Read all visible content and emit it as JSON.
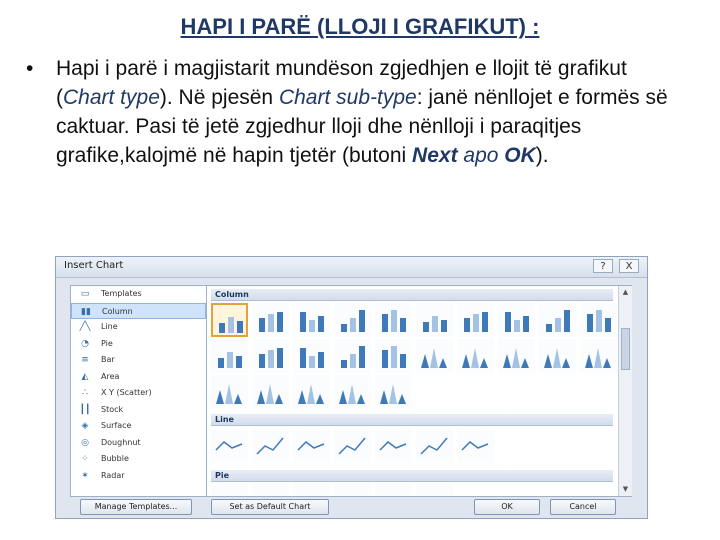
{
  "slide": {
    "title": "HAPI I PARË (LLOJI I GRAFIKUT) :",
    "bullet": {
      "part1": "Hapi i parë i magjistarit mundëson zgjedhjen e llojit të grafikut (",
      "chart_type": "Chart type",
      "part2": "). Në pjesën ",
      "chart_subtype": "Chart sub-type",
      "part3": ": janë  nënllojet e formës së caktuar. Pasi të jetë zgjedhur lloji dhe nënlloji i paraqitjes grafike,kalojmë në hapin tjetër (butoni ",
      "next": "Next",
      "apo": " apo ",
      "ok": "OK",
      "part4": ")."
    }
  },
  "dialog": {
    "title": "Insert Chart",
    "help_glyph": "?",
    "close_glyph": "X",
    "chart_types": [
      {
        "label": "Templates",
        "icon": "folder-icon",
        "glyph": "▭"
      },
      {
        "label": "Column",
        "icon": "column-chart-icon",
        "glyph": "▮▮",
        "selected": true
      },
      {
        "label": "Line",
        "icon": "line-chart-icon",
        "glyph": "╱╲"
      },
      {
        "label": "Pie",
        "icon": "pie-chart-icon",
        "glyph": "◔"
      },
      {
        "label": "Bar",
        "icon": "bar-chart-icon",
        "glyph": "≡"
      },
      {
        "label": "Area",
        "icon": "area-chart-icon",
        "glyph": "◭"
      },
      {
        "label": "X Y (Scatter)",
        "icon": "scatter-chart-icon",
        "glyph": "∴"
      },
      {
        "label": "Stock",
        "icon": "stock-chart-icon",
        "glyph": "┃┃"
      },
      {
        "label": "Surface",
        "icon": "surface-chart-icon",
        "glyph": "◈"
      },
      {
        "label": "Doughnut",
        "icon": "doughnut-chart-icon",
        "glyph": "◎"
      },
      {
        "label": "Bubble",
        "icon": "bubble-chart-icon",
        "glyph": "⁘"
      },
      {
        "label": "Radar",
        "icon": "radar-chart-icon",
        "glyph": "✶"
      }
    ],
    "sections": {
      "column": "Column",
      "line": "Line",
      "pie": "Pie"
    },
    "buttons": {
      "manage_templates": "Manage Templates...",
      "set_default": "Set as Default Chart",
      "ok": "OK",
      "cancel": "Cancel"
    },
    "colors": {
      "accent": "#1f3864",
      "bar": "#3f79b8",
      "selection": "#e4a33a"
    }
  }
}
